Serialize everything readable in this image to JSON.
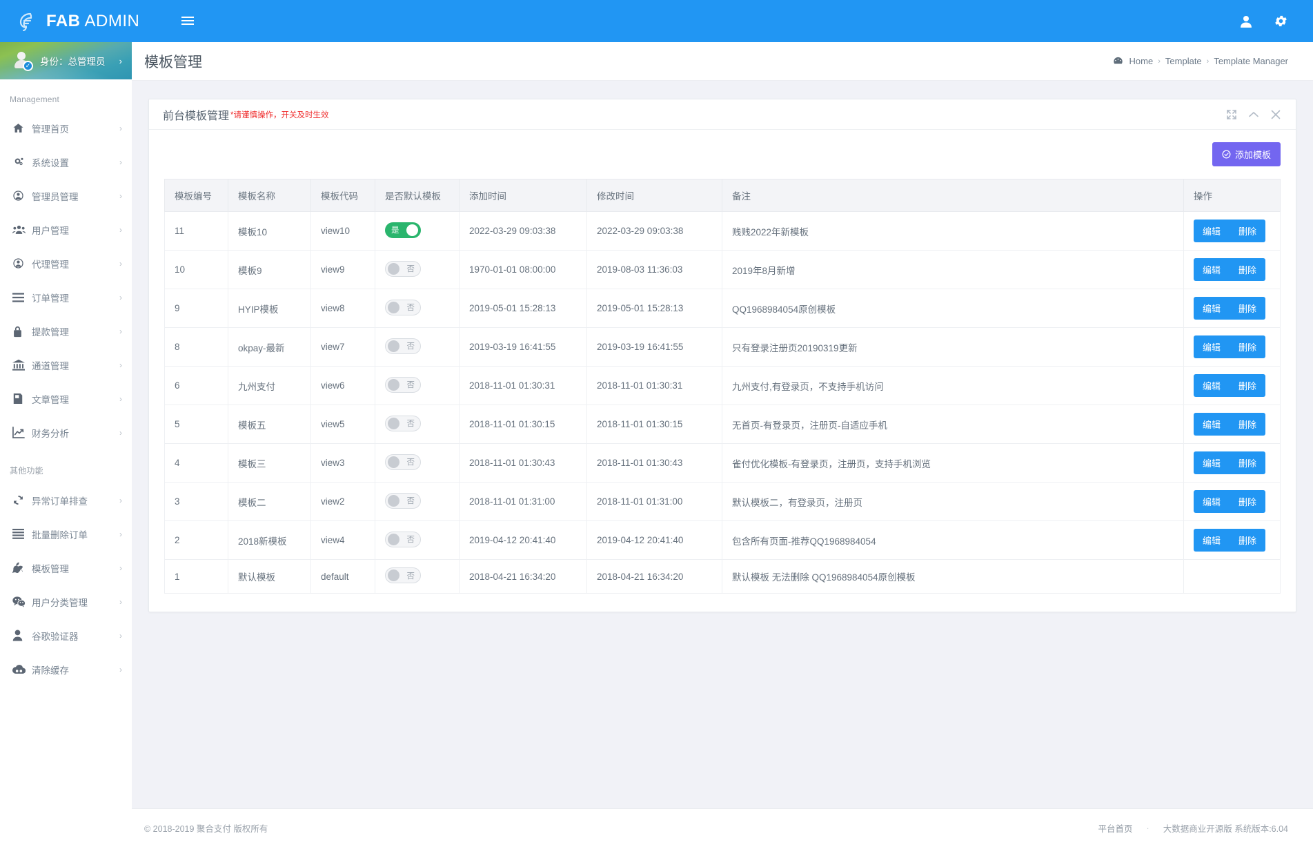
{
  "brand": {
    "strong": "FAB",
    "light": "ADMIN",
    "logo_icon": "fab-logo-icon"
  },
  "topbar": {
    "menu_toggle_icon": "hamburger-icon",
    "user_icon": "user-icon",
    "settings_icon": "gear-icon"
  },
  "sidebar": {
    "profile": {
      "label": "身份：总管理员",
      "arrow": "›",
      "avatar_icon": "avatar-verified-icon"
    },
    "sections": [
      {
        "title": "Management",
        "items": [
          {
            "label": "管理首页",
            "icon": "home-icon",
            "arrow": "›"
          },
          {
            "label": "系统设置",
            "icon": "cogs-icon",
            "arrow": "›"
          },
          {
            "label": "管理员管理",
            "icon": "user-circle-icon",
            "arrow": "›"
          },
          {
            "label": "用户管理",
            "icon": "users-icon",
            "arrow": "›"
          },
          {
            "label": "代理管理",
            "icon": "user-circle-icon",
            "arrow": "›"
          },
          {
            "label": "订单管理",
            "icon": "bars-icon",
            "arrow": "›"
          },
          {
            "label": "提款管理",
            "icon": "lock-icon",
            "arrow": "›"
          },
          {
            "label": "通道管理",
            "icon": "bank-icon",
            "arrow": "›"
          },
          {
            "label": "文章管理",
            "icon": "book-icon",
            "arrow": "›"
          },
          {
            "label": "财务分析",
            "icon": "line-chart-icon",
            "arrow": "›"
          }
        ]
      },
      {
        "title": "其他功能",
        "items": [
          {
            "label": "异常订单排查",
            "icon": "refresh-icon",
            "arrow": "›"
          },
          {
            "label": "批量删除订单",
            "icon": "bars-icon",
            "arrow": "›"
          },
          {
            "label": "模板管理",
            "icon": "apple-icon",
            "arrow": "›"
          },
          {
            "label": "用户分类管理",
            "icon": "wechat-icon",
            "arrow": "›"
          },
          {
            "label": "谷歌验证器",
            "icon": "user-solid-icon",
            "arrow": "›"
          },
          {
            "label": "清除缓存",
            "icon": "cloud-icon",
            "arrow": "›"
          }
        ]
      }
    ]
  },
  "page": {
    "title": "模板管理",
    "breadcrumb": {
      "home_icon": "dashboard-icon",
      "items": [
        "Home",
        "Template",
        "Template Manager"
      ],
      "separator": "›"
    }
  },
  "panel": {
    "title": "前台模板管理",
    "title_warning": "*请谨慎操作，开关及时生效",
    "tools": [
      {
        "icon": "expand-icon"
      },
      {
        "icon": "chevron-up-icon"
      },
      {
        "icon": "close-icon"
      }
    ],
    "add_button": {
      "label": "添加模板",
      "icon": "check-circle-icon",
      "color": "#7366f0"
    }
  },
  "table": {
    "columns": [
      "模板编号",
      "模板名称",
      "模板代码",
      "是否默认模板",
      "添加时间",
      "修改时间",
      "备注",
      "操作"
    ],
    "actions": {
      "edit": "编辑",
      "delete": "删除",
      "color": "#2196f3"
    },
    "switch_labels": {
      "on": "是",
      "off": "否"
    },
    "rows": [
      {
        "id": "11",
        "name": "模板10",
        "code": "view10",
        "is_default": true,
        "added": "2022-03-29 09:03:38",
        "modified": "2022-03-29 09:03:38",
        "remark": "贱贱2022年新模板",
        "has_actions": true
      },
      {
        "id": "10",
        "name": "模板9",
        "code": "view9",
        "is_default": false,
        "added": "1970-01-01 08:00:00",
        "modified": "2019-08-03 11:36:03",
        "remark": "2019年8月新增",
        "has_actions": true
      },
      {
        "id": "9",
        "name": "HYIP模板",
        "code": "view8",
        "is_default": false,
        "added": "2019-05-01 15:28:13",
        "modified": "2019-05-01 15:28:13",
        "remark": "QQ1968984054原创模板",
        "has_actions": true
      },
      {
        "id": "8",
        "name": "okpay-最新",
        "code": "view7",
        "is_default": false,
        "added": "2019-03-19 16:41:55",
        "modified": "2019-03-19 16:41:55",
        "remark": "只有登录注册页20190319更新",
        "has_actions": true
      },
      {
        "id": "6",
        "name": "九州支付",
        "code": "view6",
        "is_default": false,
        "added": "2018-11-01 01:30:31",
        "modified": "2018-11-01 01:30:31",
        "remark": "九州支付,有登录页，不支持手机访问",
        "has_actions": true
      },
      {
        "id": "5",
        "name": "模板五",
        "code": "view5",
        "is_default": false,
        "added": "2018-11-01 01:30:15",
        "modified": "2018-11-01 01:30:15",
        "remark": "无首页-有登录页，注册页-自适应手机",
        "has_actions": true
      },
      {
        "id": "4",
        "name": "模板三",
        "code": "view3",
        "is_default": false,
        "added": "2018-11-01 01:30:43",
        "modified": "2018-11-01 01:30:43",
        "remark": "雀付优化模板-有登录页，注册页，支持手机浏览",
        "has_actions": true
      },
      {
        "id": "3",
        "name": "模板二",
        "code": "view2",
        "is_default": false,
        "added": "2018-11-01 01:31:00",
        "modified": "2018-11-01 01:31:00",
        "remark": "默认模板二，有登录页，注册页",
        "has_actions": true
      },
      {
        "id": "2",
        "name": "2018新模板",
        "code": "view4",
        "is_default": false,
        "added": "2019-04-12 20:41:40",
        "modified": "2019-04-12 20:41:40",
        "remark": "包含所有页面-推荐QQ1968984054",
        "has_actions": true
      },
      {
        "id": "1",
        "name": "默认模板",
        "code": "default",
        "is_default": false,
        "added": "2018-04-21 16:34:20",
        "modified": "2018-04-21 16:34:20",
        "remark": "默认模板 无法删除 QQ1968984054原创模板",
        "has_actions": false
      }
    ]
  },
  "footer": {
    "copyright": "© 2018-2019 聚合支付 版权所有",
    "link": "平台首页",
    "dot": "·",
    "version": "大数据商业开源版 系统版本:6.04"
  }
}
